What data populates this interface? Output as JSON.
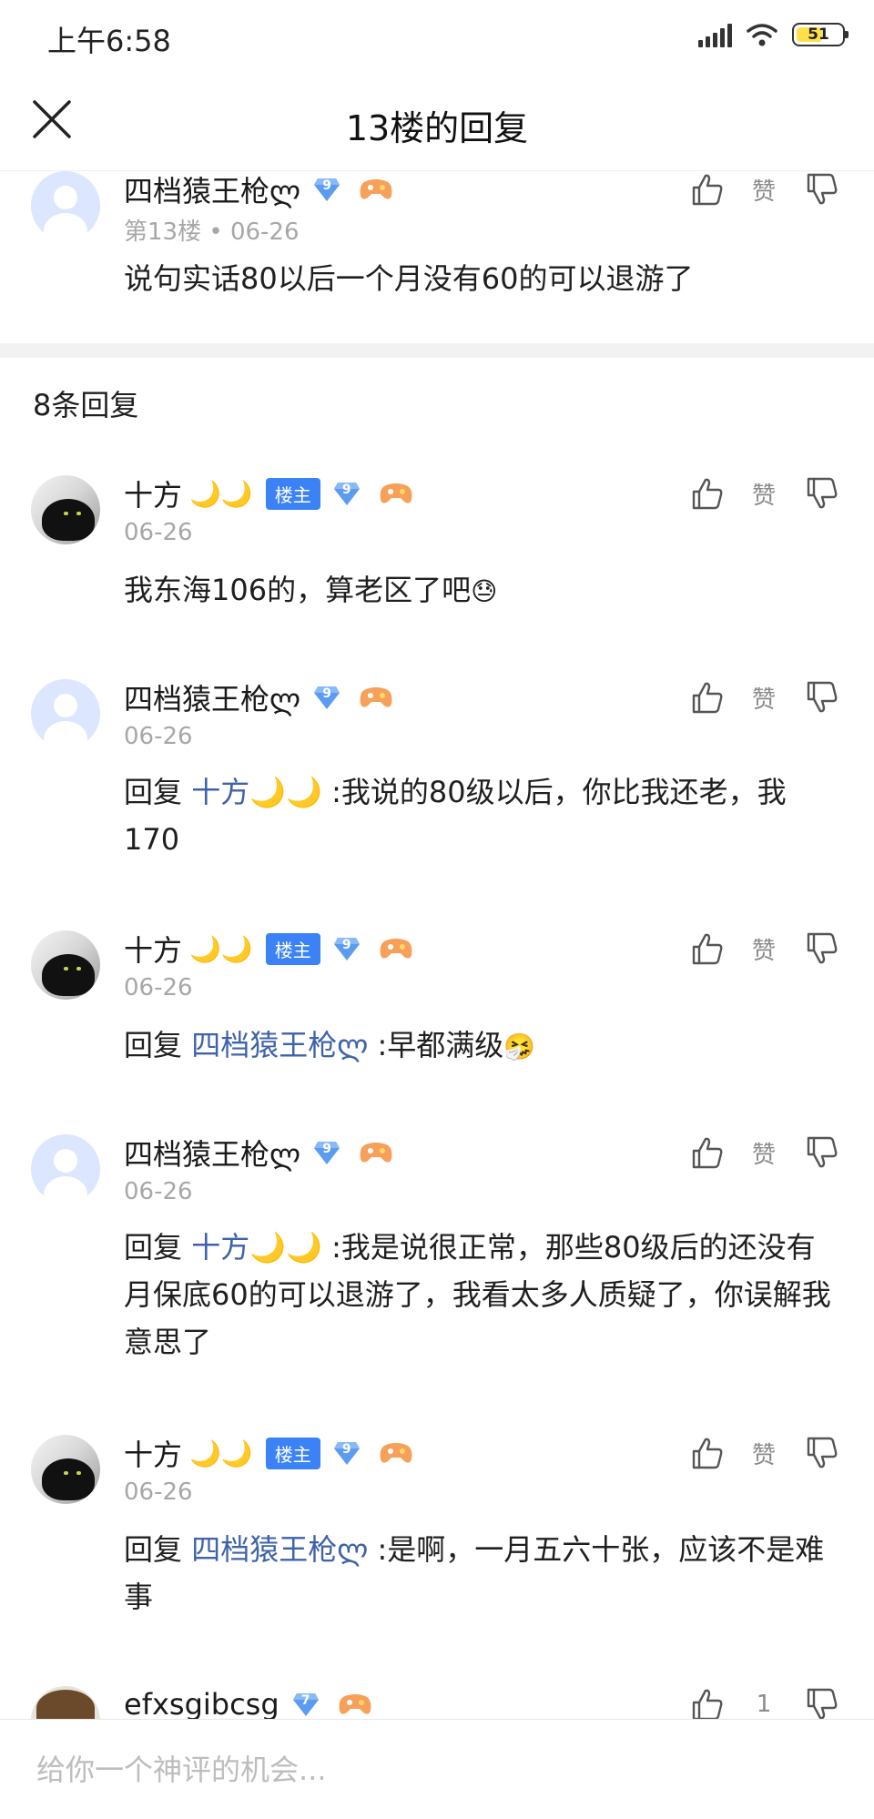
{
  "status_bar": {
    "time": "上午6:58",
    "battery": "51"
  },
  "header": {
    "title": "13楼的回复"
  },
  "main_comment": {
    "username": "四档猿王枪ლ",
    "level": "9",
    "meta": "第13楼 • 06-26",
    "text": "说句实话80以后一个月没有60的可以退游了",
    "like_label": "赞",
    "dislike_label": "踩"
  },
  "replies_header": "8条回复",
  "owner_badge": "楼主",
  "replies": [
    {
      "username": "十方",
      "moons": "🌙🌙",
      "level": "9",
      "date": "06-26",
      "text": "我东海106的，算老区了吧",
      "emoji": "😓",
      "like_label": "赞",
      "dislike_label": "踩"
    },
    {
      "username": "四档猿王枪ლ",
      "level": "9",
      "date": "06-26",
      "reply_prefix": "回复",
      "reply_to": "十方🌙🌙",
      "text": " :我说的80级以后，你比我还老，我170",
      "like_label": "赞",
      "dislike_label": "踩"
    },
    {
      "username": "十方",
      "moons": "🌙🌙",
      "level": "9",
      "date": "06-26",
      "reply_prefix": "回复",
      "reply_to": "四档猿王枪ლ",
      "text": " :早都满级",
      "emoji": "🤧",
      "like_label": "赞",
      "dislike_label": "踩"
    },
    {
      "username": "四档猿王枪ლ",
      "level": "9",
      "date": "06-26",
      "reply_prefix": "回复",
      "reply_to": "十方🌙🌙",
      "text": " :我是说很正常，那些80级后的还没有月保底60的可以退游了，我看太多人质疑了，你误解我意思了",
      "like_label": "赞",
      "dislike_label": "踩"
    },
    {
      "username": "十方",
      "moons": "🌙🌙",
      "level": "9",
      "date": "06-26",
      "reply_prefix": "回复",
      "reply_to": "四档猿王枪ლ",
      "text": " :是啊，一月五六十张，应该不是难事",
      "like_label": "赞",
      "dislike_label": "踩"
    },
    {
      "username": "efxsgibcsg",
      "level": "7",
      "like_count": "1"
    }
  ],
  "input": {
    "placeholder": "给你一个神评的机会..."
  },
  "colors": {
    "accent": "#3b82f6",
    "link": "#3f63a8",
    "meta": "#a7a7a7"
  }
}
